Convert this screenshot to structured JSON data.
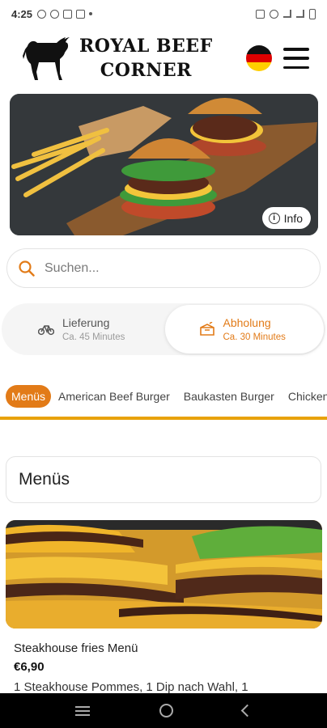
{
  "status_bar": {
    "time": "4:25"
  },
  "header": {
    "brand_line1": "ROYAL BEEF",
    "brand_line2": "CORNER",
    "logo_icon": "bull-logo-icon",
    "language_flag": "germany-flag-icon",
    "menu_icon": "hamburger-menu-icon"
  },
  "hero": {
    "info_label": "Info"
  },
  "search": {
    "placeholder": "Suchen..."
  },
  "delivery": {
    "options": [
      {
        "title": "Lieferung",
        "subtitle": "Ca. 45 Minutes",
        "icon": "bicycle-icon",
        "active": false
      },
      {
        "title": "Abholung",
        "subtitle": "Ca. 30 Minutes",
        "icon": "pickup-box-icon",
        "active": true
      }
    ]
  },
  "categories": [
    {
      "label": "Menüs",
      "active": true
    },
    {
      "label": "American Beef Burger",
      "active": false
    },
    {
      "label": "Baukasten Burger",
      "active": false
    },
    {
      "label": "Chicken",
      "active": false
    }
  ],
  "section": {
    "title": "Menüs"
  },
  "product": {
    "name": "Steakhouse fries Menü",
    "price": "€6,90",
    "description": "1 Steakhouse Pommes, 1 Dip nach Wahl, 1"
  },
  "colors": {
    "accent": "#e27b18",
    "underline": "#e8a20a"
  }
}
